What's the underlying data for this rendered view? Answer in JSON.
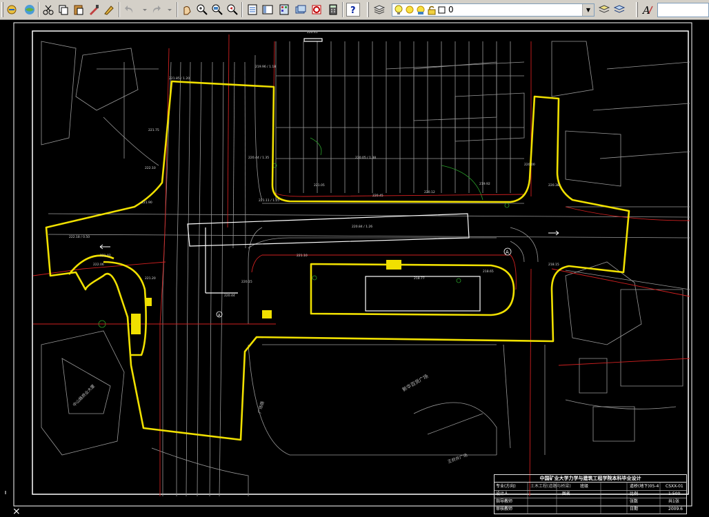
{
  "toolbar": {
    "buttons": [
      "publish",
      "3d-dwf",
      "cut",
      "copy",
      "paste",
      "match-properties",
      "block-editor",
      "undo",
      "redo",
      "pan",
      "zoom-realtime",
      "zoom-window",
      "zoom-previous",
      "properties",
      "design-center",
      "tool-palettes",
      "sheet-set-manager",
      "markup-set-manager",
      "quickcalc",
      "help",
      "layer-manager",
      "layer-state"
    ],
    "layer": {
      "current_name": "0"
    }
  },
  "title_block": {
    "header": "中国矿业大学力学与建筑工程学院本科毕业设计",
    "row1": [
      "专业(方向)",
      "土木工程(道路与桥梁)",
      "班级",
      "道桥(地下)05-4",
      "图号",
      "CSXX-01"
    ],
    "row2": [
      "设计人",
      "",
      "图名",
      "",
      "比例",
      "1:500"
    ],
    "row3": [
      "指导教师",
      "",
      "",
      "",
      "张数",
      "共1张"
    ],
    "row4": [
      "审核教师",
      "",
      "",
      "",
      "日期",
      "2009.6"
    ]
  },
  "labels": {
    "plaza": "新华百货广场",
    "building_left": "中山路商业大厦",
    "road_label": "王府井广场",
    "circle_a1": "A",
    "circle_a2": "A"
  }
}
